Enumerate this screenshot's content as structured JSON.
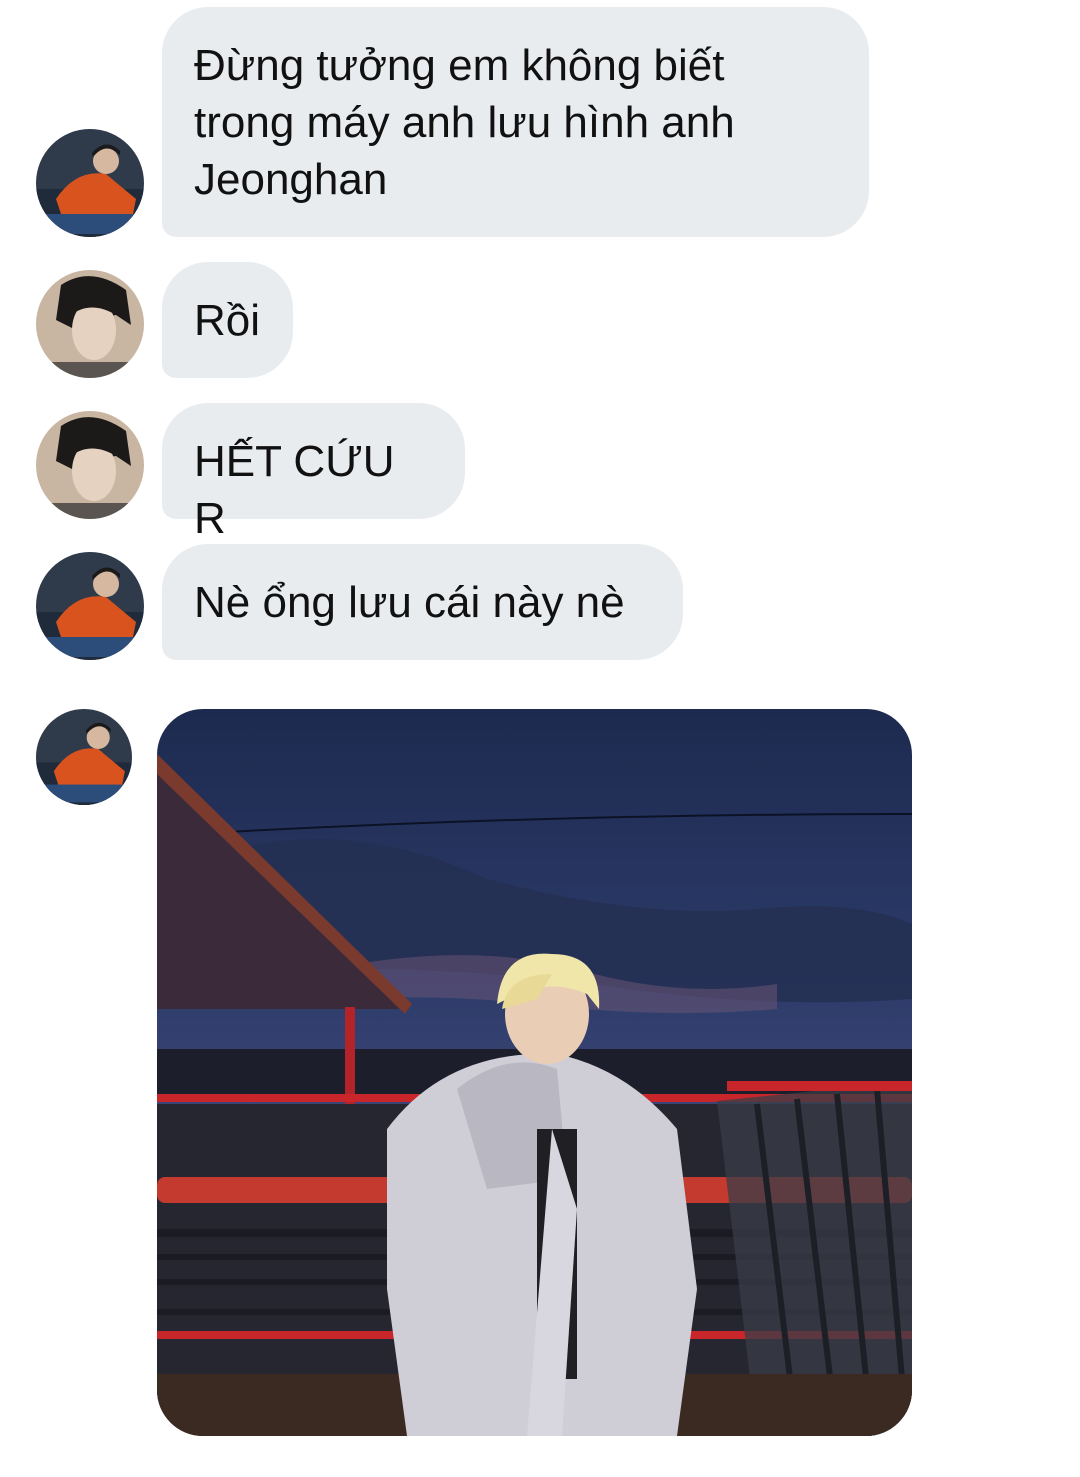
{
  "messages": [
    {
      "sender": "avatar-a",
      "lines": [
        "Đừng tưởng em không biết",
        "trong máy anh lưu hình anh",
        "Jeonghan"
      ]
    },
    {
      "sender": "avatar-b",
      "text": "Rồi"
    },
    {
      "sender": "avatar-b",
      "text": "HẾT CỨU R"
    },
    {
      "sender": "avatar-a",
      "text": "Nè ổng lưu cái này nè"
    },
    {
      "sender": "avatar-a",
      "type": "photo",
      "content": "photo-image"
    }
  ],
  "colors": {
    "bubble_background": "#e9ecef",
    "text": "#111111",
    "background": "#ffffff"
  }
}
